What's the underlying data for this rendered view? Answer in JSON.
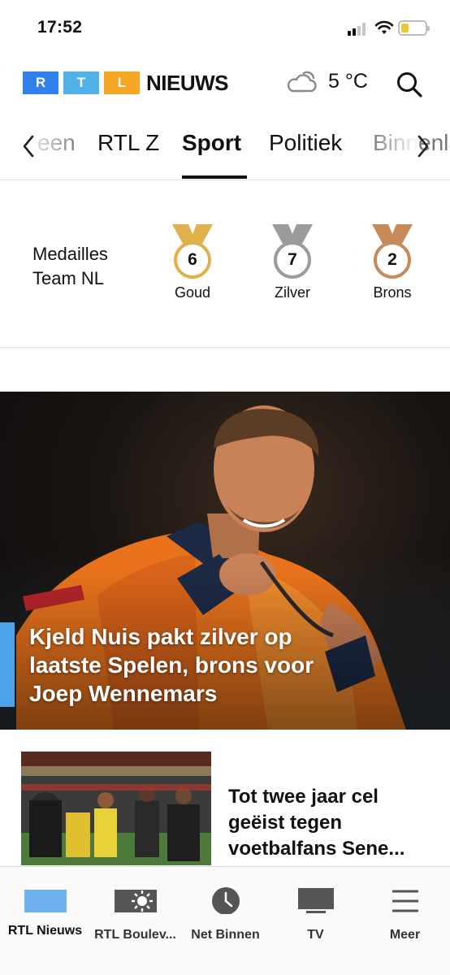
{
  "status_bar": {
    "time": "17:52"
  },
  "header": {
    "logo_letters": [
      "R",
      "T",
      "L"
    ],
    "logo_colors": [
      "#2f80ed",
      "#52b2e8",
      "#f5a623"
    ],
    "brand": "NIEUWS",
    "temperature": "5 °C",
    "weather_icon": "cloud-sun-icon",
    "search_icon": "search-icon"
  },
  "tabs": {
    "items": [
      {
        "label": "een"
      },
      {
        "label": "RTL Z"
      },
      {
        "label": "Sport",
        "active": true
      },
      {
        "label": "Politiek"
      },
      {
        "label": "Binnenland"
      }
    ]
  },
  "medals": {
    "title": "Medailles Team NL",
    "items": [
      {
        "label": "Goud",
        "count": "6",
        "color": "#e0b04a"
      },
      {
        "label": "Zilver",
        "count": "7",
        "color": "#9b9b9b"
      },
      {
        "label": "Brons",
        "count": "2",
        "color": "#c98a5a"
      }
    ]
  },
  "hero": {
    "headline": "Kjeld Nuis pakt zilver op laatste Spelen, brons voor Joep Wennemars",
    "accent_color": "#4da3e8"
  },
  "articles": [
    {
      "title": "Tot twee jaar cel geëist tegen voetbalfans Sene..."
    }
  ],
  "bottom_nav": {
    "items": [
      {
        "label": "RTL Nieuws",
        "icon": "rtl-nieuws-icon",
        "active": true
      },
      {
        "label": "RTL Boulev...",
        "icon": "boulevard-icon"
      },
      {
        "label": "Net Binnen",
        "icon": "clock-icon"
      },
      {
        "label": "TV",
        "icon": "tv-icon"
      },
      {
        "label": "Meer",
        "icon": "menu-icon"
      }
    ]
  }
}
